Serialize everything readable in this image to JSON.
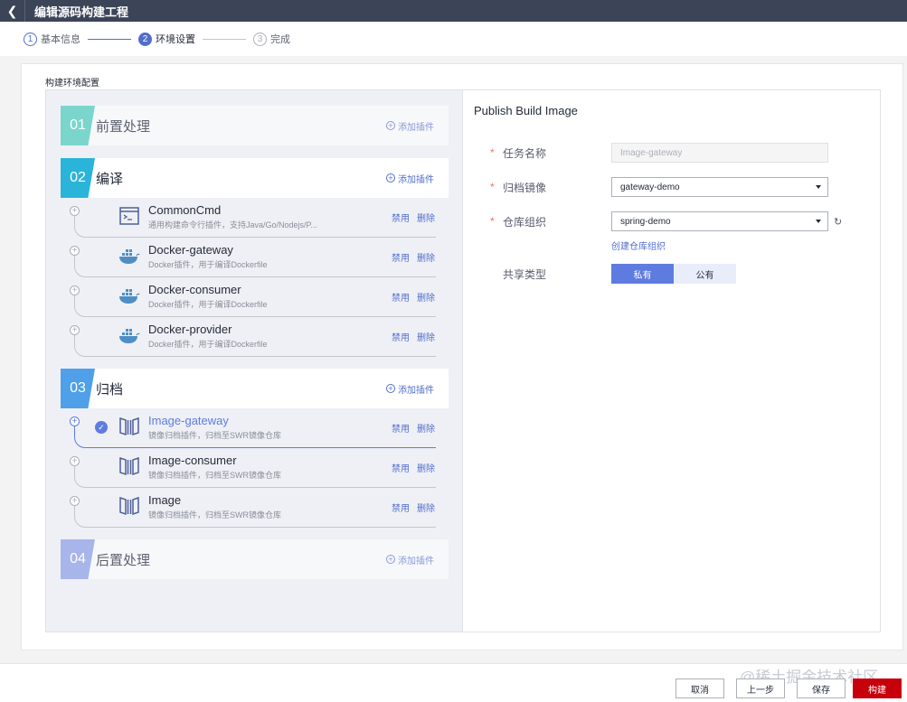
{
  "header": {
    "title": "编辑源码构建工程",
    "back_icon": "chevron-left-icon"
  },
  "steps": [
    {
      "num": "1",
      "label": "基本信息",
      "state": "done"
    },
    {
      "num": "2",
      "label": "环境设置",
      "state": "active"
    },
    {
      "num": "3",
      "label": "完成",
      "state": "todo"
    }
  ],
  "panel": {
    "title": "构建环境配置"
  },
  "stages": [
    {
      "num": "01",
      "name": "前置处理",
      "add_label": "添加插件",
      "color": "#7ad6cc"
    },
    {
      "num": "02",
      "name": "编译",
      "add_label": "添加插件",
      "color": "#2bb4d9"
    },
    {
      "num": "03",
      "name": "归档",
      "add_label": "添加插件",
      "color": "#4fa0e8"
    },
    {
      "num": "04",
      "name": "后置处理",
      "add_label": "添加插件",
      "color": "#a8b5ea"
    }
  ],
  "compile_tasks": [
    {
      "name": "CommonCmd",
      "desc": "通用构建命令行插件，支持Java/Go/Nodejs/P...",
      "icon": "terminal-icon",
      "disable": "禁用",
      "delete": "删除"
    },
    {
      "name": "Docker-gateway",
      "desc": "Docker插件，用于编译Dockerfile",
      "icon": "docker-icon",
      "disable": "禁用",
      "delete": "删除"
    },
    {
      "name": "Docker-consumer",
      "desc": "Docker插件，用于编译Dockerfile",
      "icon": "docker-icon",
      "disable": "禁用",
      "delete": "删除"
    },
    {
      "name": "Docker-provider",
      "desc": "Docker插件，用于编译Dockerfile",
      "icon": "docker-icon",
      "disable": "禁用",
      "delete": "删除"
    }
  ],
  "archive_tasks": [
    {
      "name": "Image-gateway",
      "desc": "镜像归档插件，归档至SWR镜像仓库",
      "icon": "image-archive-icon",
      "selected": true,
      "disable": "禁用",
      "delete": "删除"
    },
    {
      "name": "Image-consumer",
      "desc": "镜像归档插件，归档至SWR镜像仓库",
      "icon": "image-archive-icon",
      "selected": false,
      "disable": "禁用",
      "delete": "删除"
    },
    {
      "name": "Image",
      "desc": "镜像归档插件，归档至SWR镜像仓库",
      "icon": "image-archive-icon",
      "selected": false,
      "disable": "禁用",
      "delete": "删除"
    }
  ],
  "form": {
    "title": "Publish Build Image",
    "task_name": {
      "label": "任务名称",
      "value": "Image-gateway",
      "required": true
    },
    "archive_image": {
      "label": "归档镜像",
      "value": "gateway-demo",
      "required": true
    },
    "repo_org": {
      "label": "仓库组织",
      "value": "spring-demo",
      "required": true
    },
    "create_org_link": "创建仓库组织",
    "share_type": {
      "label": "共享类型",
      "options": [
        "私有",
        "公有"
      ],
      "selected": "私有"
    }
  },
  "footer": {
    "watermark": "@稀土掘金技术社区",
    "cancel": "取消",
    "prev": "上一步",
    "save": "保存",
    "build": "构建"
  },
  "colors": {
    "accent": "#526ecc",
    "danger": "#c7000b",
    "topbar": "#3c4458"
  }
}
